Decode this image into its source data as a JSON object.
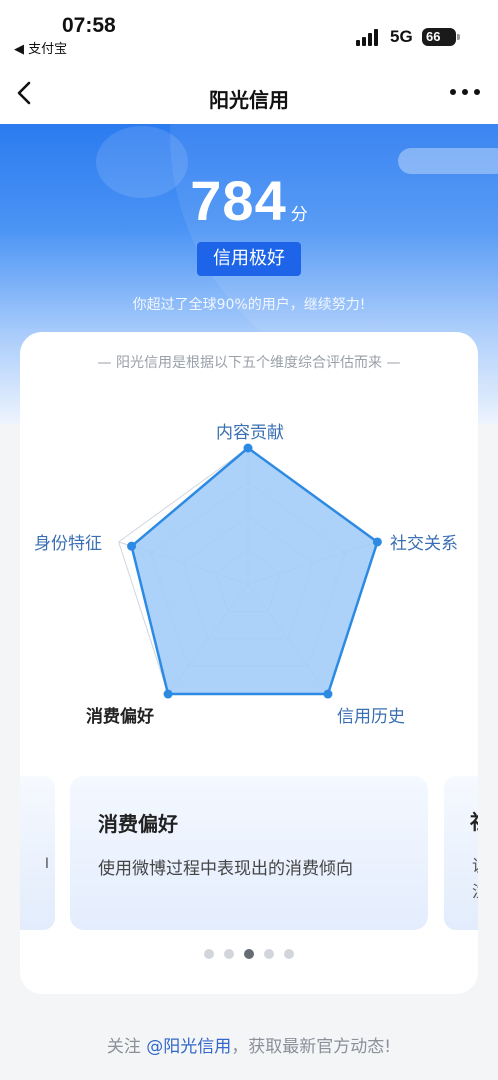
{
  "status_bar": {
    "time": "07:58",
    "back_app": "◀ 支付宝",
    "network": "5G",
    "battery": "66"
  },
  "nav": {
    "title": "阳光信用"
  },
  "hero": {
    "score": "784",
    "score_unit": "分",
    "level": "信用极好",
    "exceed_text": "你超过了全球90%的用户，继续努力!"
  },
  "dimensions": {
    "caption": "— 阳光信用是根据以下五个维度综合评估而来 —",
    "labels": {
      "content": "内容贡献",
      "social": "社交关系",
      "history": "信用历史",
      "consumption": "消费偏好",
      "identity": "身份特征"
    },
    "levels": {
      "content": 1.0,
      "social": 1.0,
      "history": 1.0,
      "consumption": 1.0,
      "identity": 0.9
    },
    "colors": {
      "fill": "#a3cdf8",
      "stroke": "#2d8ae3",
      "grid": "#cfd6df"
    }
  },
  "carousel": {
    "left_fragment": "I",
    "active_title": "消费偏好",
    "active_desc": "使用微博过程中表现出的消费倾向",
    "right_title": "社",
    "right_desc_1": "说",
    "right_desc_2": "注",
    "active_index": 2,
    "count": 5
  },
  "footer": {
    "prefix": "关注 ",
    "link": "@阳光信用",
    "suffix": "，获取最新官方动态!"
  }
}
